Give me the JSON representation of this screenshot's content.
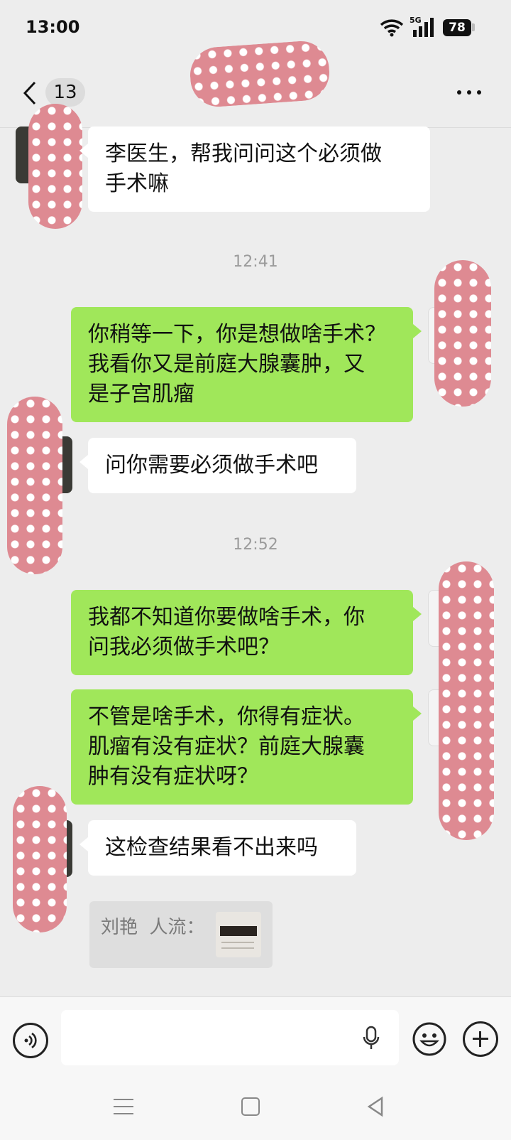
{
  "status_bar": {
    "time": "13:00",
    "network": "5G",
    "battery": "78"
  },
  "header": {
    "unread_count": "13",
    "title": ""
  },
  "messages": [
    {
      "direction": "in",
      "text": "李医生，帮我问问这个必须做\n手术嘛"
    },
    {
      "timestamp": "12:41"
    },
    {
      "direction": "out",
      "text": "你稍等一下，你是想做啥手术？\n我看你又是前庭大腺囊肿，又\n是子宫肌瘤"
    },
    {
      "direction": "in",
      "text": "问你需要必须做手术吧"
    },
    {
      "timestamp": "12:52"
    },
    {
      "direction": "out",
      "text": "我都不知道你要做啥手术，你\n问我必须做手术吧？"
    },
    {
      "direction": "out",
      "text": "不管是啥手术，你得有症状。\n肌瘤有没有症状？前庭大腺囊\n肿有没有症状呀？"
    },
    {
      "direction": "in",
      "text": "这检查结果看不出来吗"
    }
  ],
  "quote": {
    "text": "刘艳  人流："
  },
  "input": {
    "placeholder": ""
  },
  "colors": {
    "outgoing_bubble": "#a0e75a",
    "incoming_bubble": "#ffffff",
    "background": "#ededed",
    "redaction": "#de8a92"
  },
  "icons": [
    "wifi-icon",
    "signal-icon",
    "back-chevron-icon",
    "more-icon",
    "voice-icon",
    "mic-icon",
    "emoji-icon",
    "plus-icon",
    "nav-menu-icon",
    "nav-home-icon",
    "nav-back-icon"
  ]
}
